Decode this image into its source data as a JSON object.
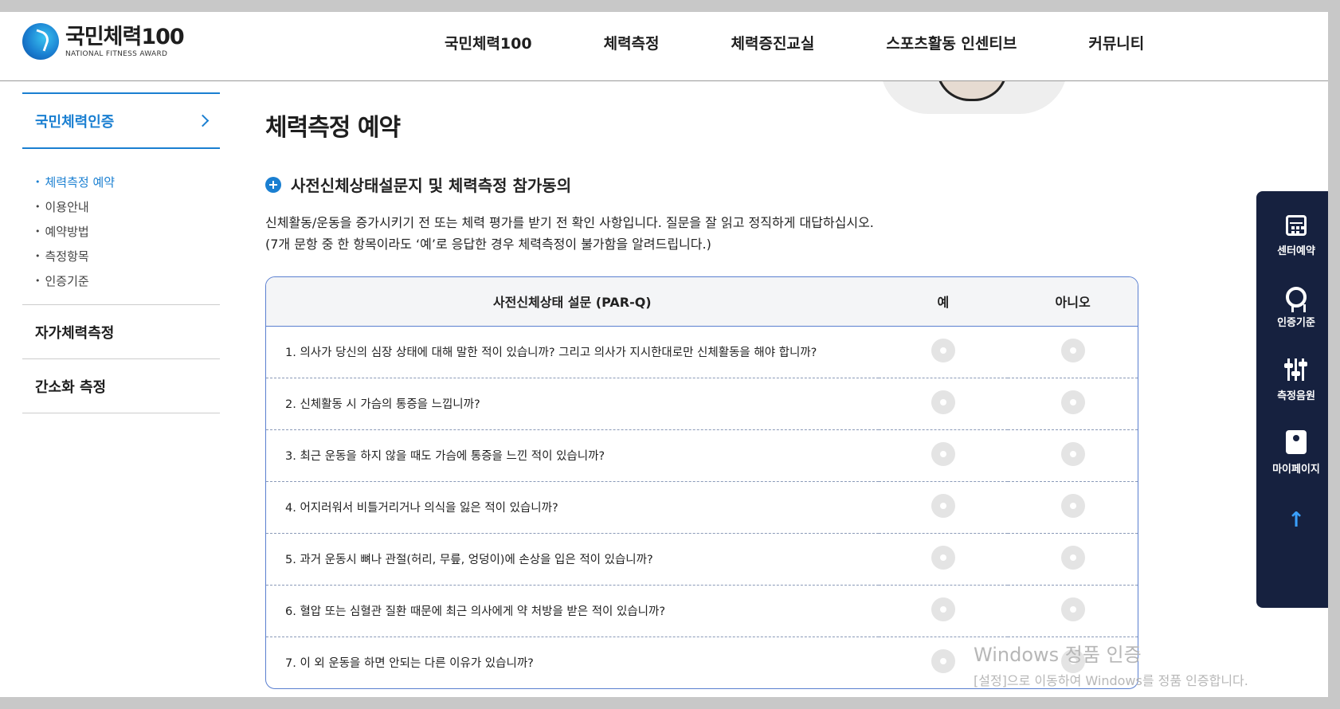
{
  "header": {
    "logo_title": "국민체력100",
    "logo_sub": "NATIONAL FITNESS AWARD",
    "nav": [
      "국민체력100",
      "체력측정",
      "체력증진교실",
      "스포츠활동 인센티브",
      "커뮤니티"
    ]
  },
  "sidebar": {
    "head": "국민체력인증",
    "sub_items": [
      "체력측정 예약",
      "이용안내",
      "예약방법",
      "측정항목",
      "인증기준"
    ],
    "menus": [
      "자가체력측정",
      "간소화 측정"
    ]
  },
  "main": {
    "title": "체력측정 예약",
    "section_title": "사전신체상태설문지 및 체력측정 참가동의",
    "desc_line1": "신체활동/운동을 증가시키기 전 또는 체력 평가를 받기 전 확인 사항입니다. 질문을 잘 읽고 정직하게 대답하십시오.",
    "desc_line2": "(7개 문항 중 한 항목이라도 ‘예’로 응답한 경우 체력측정이 불가함을 알려드립니다.)",
    "table": {
      "col_question": "사전신체상태 설문 (PAR-Q)",
      "col_yes": "예",
      "col_no": "아니오",
      "rows": [
        "1. 의사가 당신의 심장 상태에 대해 말한 적이 있습니까? 그리고 의사가 지시한대로만 신체활동을 해야 합니까?",
        "2. 신체활동 시 가슴의 통증을 느낍니까?",
        "3. 최근 운동을 하지 않을 때도 가슴에 통증을 느낀 적이 있습니까?",
        "4. 어지러워서 비틀거리거나 의식을 잃은 적이 있습니까?",
        "5. 과거 운동시 뼈나 관절(허리, 무릎, 엉덩이)에 손상을 입은 적이 있습니까?",
        "6. 혈압 또는 심혈관 질환 때문에 최근 의사에게 약 처방을 받은 적이 있습니까?",
        "7. 이 외 운동을 하면 안되는 다른 이유가 있습니까?"
      ]
    }
  },
  "quick_menu": [
    {
      "label": "센터예약",
      "icon": "calendar-icon"
    },
    {
      "label": "인증기준",
      "icon": "badge-icon"
    },
    {
      "label": "측정음원",
      "icon": "sliders-icon"
    },
    {
      "label": "마이페이지",
      "icon": "mypage-icon"
    }
  ],
  "watermark": {
    "line1": "Windows 정품 인증",
    "line2": "[설정]으로 이동하여 Windows를 정품 인증합니다."
  },
  "colors": {
    "accent": "#1a7fd1",
    "quick_bg": "#16213f",
    "table_border": "#5a7fd0"
  }
}
